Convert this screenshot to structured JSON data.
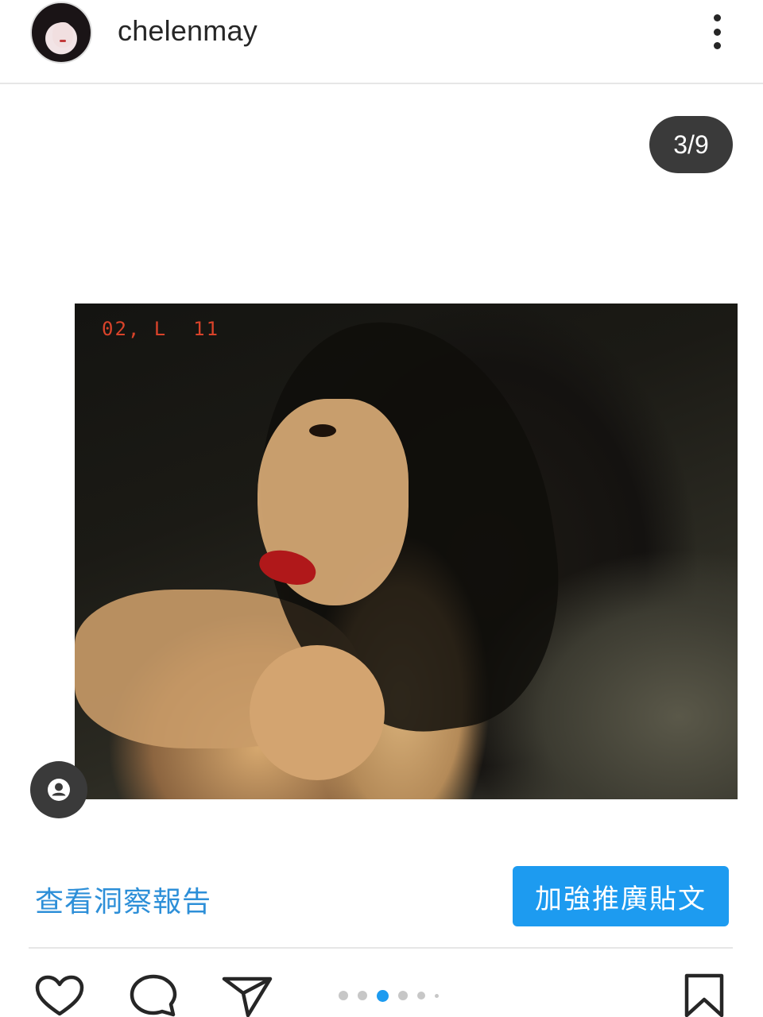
{
  "header": {
    "username": "chelenmay"
  },
  "carousel": {
    "counter": "3/9",
    "photo_timestamp": "02, L  11",
    "total": 9,
    "current": 3
  },
  "promo": {
    "insights_label": "查看洞察報告",
    "promote_label": "加強推廣貼文"
  },
  "icons": {
    "more": "more-vertical-icon",
    "tag": "user-tag-icon",
    "like": "heart-icon",
    "comment": "comment-icon",
    "share": "send-icon",
    "save": "bookmark-icon"
  },
  "colors": {
    "link_blue": "#2d8fd8",
    "button_blue": "#1d9bf0",
    "active_dot": "#1d9bf0",
    "inactive_dot": "#c7c7c7"
  }
}
